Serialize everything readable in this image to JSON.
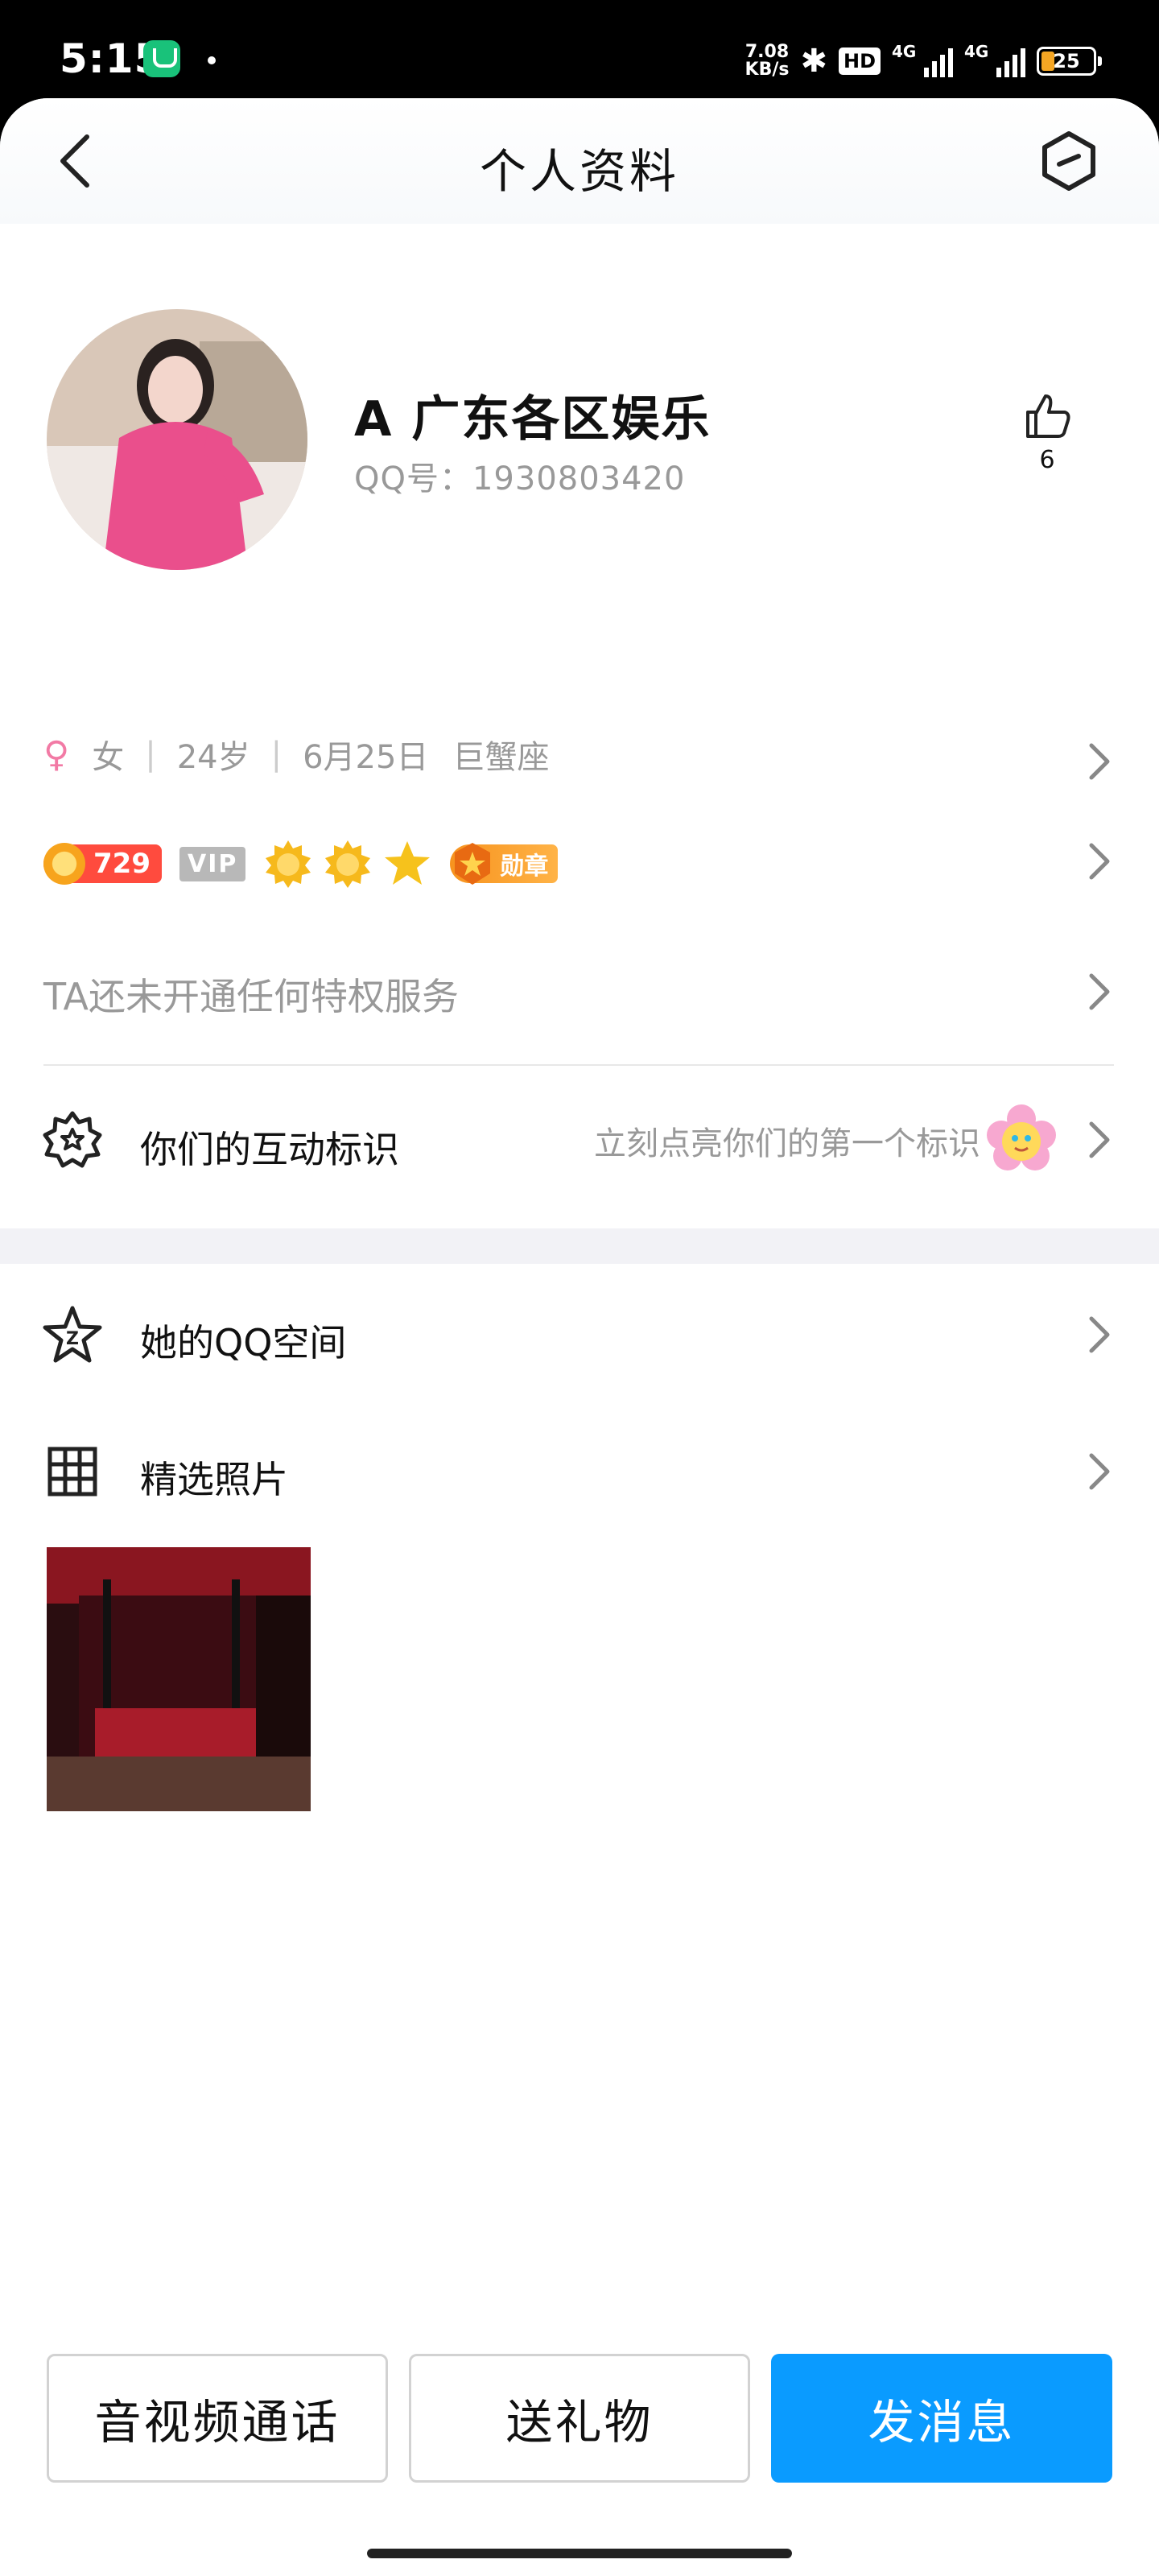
{
  "status_bar": {
    "time": "5:15",
    "net_speed_value": "7.08",
    "net_speed_unit": "KB/s",
    "hd_label": "HD",
    "signal1_label": "4G",
    "signal2_label": "4G",
    "battery": "25"
  },
  "header": {
    "title": "个人资料",
    "back_icon": "back-chevron-icon",
    "more_icon": "hexagon-more-icon"
  },
  "profile": {
    "name": "A 广东各区娱乐",
    "qq_label": "QQ号：1930803420",
    "like_count": "6"
  },
  "info": {
    "gender_symbol": "♀",
    "gender": "女",
    "age": "24岁",
    "birthday": "6月25日",
    "zodiac": "巨蟹座"
  },
  "badges": {
    "level": "729",
    "vip": "VIP",
    "medal": "勋章"
  },
  "privilege": {
    "text": "TA还未开通任何特权服务"
  },
  "interaction": {
    "label": "你们的互动标识",
    "hint": "立刻点亮你们的第一个标识"
  },
  "qzone": {
    "label": "她的QQ空间"
  },
  "photos": {
    "label": "精选照片"
  },
  "actions": {
    "call": "音视频通话",
    "gift": "送礼物",
    "message": "发消息"
  },
  "colors": {
    "accent": "#0a9bff",
    "female": "#f27aa5",
    "level_badge": "#ff4b3e",
    "medal_badge": "#f7931e"
  }
}
